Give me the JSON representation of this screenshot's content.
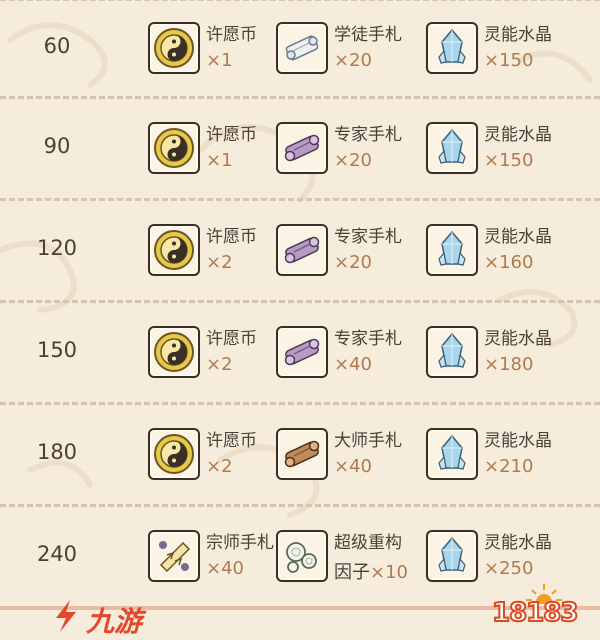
{
  "tiers": [
    {
      "level": "60",
      "rewards": [
        {
          "name": "许愿币",
          "qty": "×1",
          "icon": "coin-icon"
        },
        {
          "name": "学徒手札",
          "qty": "×20",
          "icon": "apprentice-scroll-icon"
        },
        {
          "name": "灵能水晶",
          "qty": "×150",
          "icon": "crystal-icon"
        }
      ]
    },
    {
      "level": "90",
      "rewards": [
        {
          "name": "许愿币",
          "qty": "×1",
          "icon": "coin-icon"
        },
        {
          "name": "专家手札",
          "qty": "×20",
          "icon": "expert-scroll-icon"
        },
        {
          "name": "灵能水晶",
          "qty": "×150",
          "icon": "crystal-icon"
        }
      ]
    },
    {
      "level": "120",
      "rewards": [
        {
          "name": "许愿币",
          "qty": "×2",
          "icon": "coin-icon"
        },
        {
          "name": "专家手札",
          "qty": "×20",
          "icon": "expert-scroll-icon"
        },
        {
          "name": "灵能水晶",
          "qty": "×160",
          "icon": "crystal-icon"
        }
      ]
    },
    {
      "level": "150",
      "rewards": [
        {
          "name": "许愿币",
          "qty": "×2",
          "icon": "coin-icon"
        },
        {
          "name": "专家手札",
          "qty": "×40",
          "icon": "expert-scroll-icon"
        },
        {
          "name": "灵能水晶",
          "qty": "×180",
          "icon": "crystal-icon"
        }
      ]
    },
    {
      "level": "180",
      "rewards": [
        {
          "name": "许愿币",
          "qty": "×2",
          "icon": "coin-icon"
        },
        {
          "name": "大师手札",
          "qty": "×40",
          "icon": "master-scroll-icon"
        },
        {
          "name": "灵能水晶",
          "qty": "×210",
          "icon": "crystal-icon"
        }
      ]
    },
    {
      "level": "240",
      "rewards": [
        {
          "name": "宗师手札",
          "qty": "×40",
          "icon": "grandmaster-scroll-icon"
        },
        {
          "name": "超级重构",
          "name2": "因子",
          "qty": "×10",
          "icon": "refactor-factor-icon"
        },
        {
          "name": "灵能水晶",
          "qty": "×250",
          "icon": "crystal-icon"
        }
      ]
    }
  ],
  "watermarks": {
    "left_logo": "九游",
    "right_logo": "18183"
  },
  "colors": {
    "background": "#f6ecdc",
    "text": "#4a4038",
    "quantity": "#b07b4f",
    "divider": "#d4c5b0",
    "brand_red": "#e2492b"
  }
}
